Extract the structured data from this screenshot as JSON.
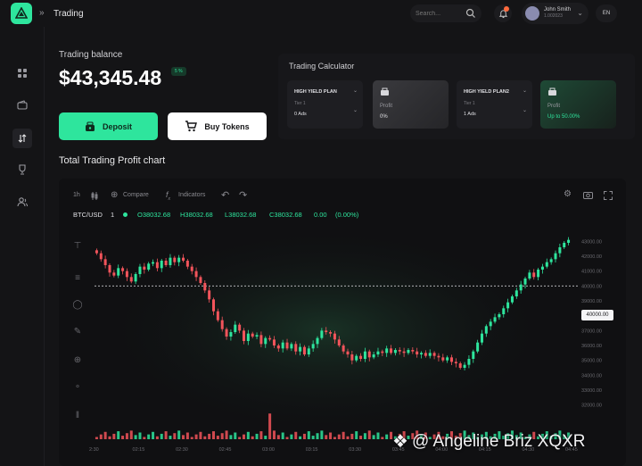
{
  "header": {
    "breadcrumb": "Trading",
    "search_placeholder": "Search...",
    "user_name": "John Smith",
    "user_sub": "1.002023",
    "lang": "EN"
  },
  "balance": {
    "label": "Trading balance",
    "value": "$43,345.48",
    "badge": "5 %",
    "deposit_label": "Deposit",
    "buy_label": "Buy Tokens"
  },
  "calculator": {
    "title": "Trading Calculator",
    "plans": [
      {
        "name": "HIGH YIELD PLAN",
        "tier": "Tier 1",
        "value": "0 Ads"
      },
      {
        "name": "HIGH YIELD PLAN2",
        "tier": "Tier 1",
        "value": "1 Ads"
      }
    ],
    "profits": [
      {
        "label": "Profit",
        "value": "0%"
      },
      {
        "label": "Profit",
        "value": "Up to 50.00%"
      }
    ]
  },
  "chart_section": {
    "heading": "Total Trading Profit chart",
    "toolbar": {
      "interval_1": "1h",
      "compare": "Compare",
      "indicators": "Indicators"
    },
    "symbol": "BTC/USD",
    "symbol_interval": "1",
    "ohlc": {
      "o": "O38032.68",
      "h": "H38032.68",
      "l": "L38032.68",
      "c": "C38032.68",
      "change": "0.00",
      "change_pct": "(0.00%)"
    },
    "current_price_label": "40000.00"
  },
  "chart_data": {
    "type": "candlestick",
    "y_ticks": [
      "43000.00",
      "42000.00",
      "41000.00",
      "40000.00",
      "39000.00",
      "38000.00",
      "37000.00",
      "36000.00",
      "35000.00",
      "34000.00",
      "33000.00",
      "32000.00"
    ],
    "x_ticks": [
      "2:30",
      "02:15",
      "02:30",
      "02:45",
      "03:00",
      "03:15",
      "03:30",
      "03:45",
      "04:00",
      "04:15",
      "04:30",
      "04:45"
    ],
    "ylim": [
      31500,
      43500
    ],
    "current_price": 40000,
    "closes": [
      42200,
      41800,
      41400,
      40900,
      40700,
      41200,
      41000,
      40600,
      40300,
      40800,
      41300,
      41100,
      41500,
      41600,
      41200,
      41700,
      41400,
      41900,
      41600,
      41900,
      41700,
      41300,
      41000,
      40600,
      40200,
      39700,
      39100,
      38300,
      37700,
      37100,
      36600,
      36900,
      37400,
      37000,
      36300,
      36800,
      36600,
      36700,
      36100,
      36500,
      36400,
      36000,
      35800,
      36200,
      35800,
      36100,
      35600,
      35900,
      35400,
      35800,
      36100,
      36500,
      37000,
      36900,
      36800,
      36400,
      36000,
      35600,
      35400,
      35000,
      35300,
      35100,
      35600,
      35200,
      35400,
      35600,
      35500,
      35800,
      35500,
      35700,
      35600,
      35500,
      35700,
      35600,
      35400,
      35500,
      35300,
      35500,
      35300,
      35200,
      35000,
      35200,
      34900,
      34800,
      34500,
      34700,
      35100,
      35600,
      36200,
      36800,
      37300,
      37600,
      37900,
      38100,
      38500,
      38900,
      39300,
      39700,
      40100,
      40500,
      40900,
      40600,
      41100,
      41300,
      41600,
      41800,
      42200,
      42600,
      42900,
      43100
    ]
  },
  "watermark": "@ Angeline Briz XQXR"
}
